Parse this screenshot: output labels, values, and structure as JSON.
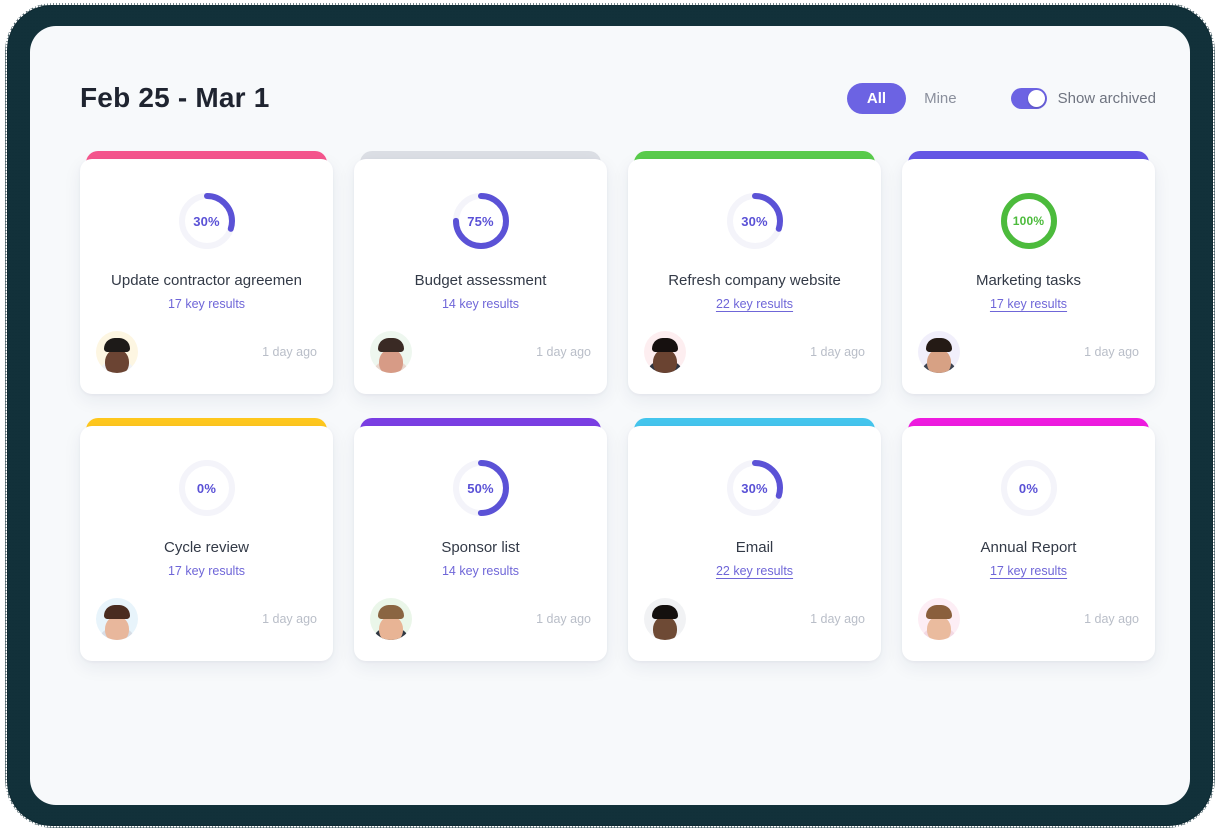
{
  "header": {
    "title": "Feb 25 - Mar 1",
    "filter_all": "All",
    "filter_mine": "Mine",
    "show_archived_label": "Show archived",
    "toggle_state": "on",
    "accent_color": "#6c63e3"
  },
  "cards": [
    {
      "title": "Update contractor agreemen",
      "key_results": "17 key results",
      "underlined": false,
      "percent": 30,
      "percent_label": "30%",
      "accent_color": "#f5558d",
      "ring_color": "#5b52d6",
      "time": "1 day ago",
      "avatar": {
        "name": "avatar-user-1",
        "bg": "#fdf6e2",
        "skin": "#6b4433",
        "hair": "#1d1a18",
        "body": "#f0f2f5"
      }
    },
    {
      "title": "Budget assessment",
      "key_results": "14 key results",
      "underlined": false,
      "percent": 75,
      "percent_label": "75%",
      "accent_color": "#dcdfe5",
      "ring_color": "#5b52d6",
      "time": "1 day ago",
      "avatar": {
        "name": "avatar-user-2",
        "bg": "#eef7ef",
        "skin": "#d79b86",
        "hair": "#3a2a24",
        "body": "#e9d8cf"
      }
    },
    {
      "title": "Refresh company website",
      "key_results": "22 key results",
      "underlined": true,
      "percent": 30,
      "percent_label": "30%",
      "accent_color": "#59cc4b",
      "ring_color": "#5b52d6",
      "time": "1 day ago",
      "avatar": {
        "name": "avatar-user-3",
        "bg": "#fdeef0",
        "skin": "#6a4331",
        "hair": "#16100f",
        "body": "#2c3340"
      }
    },
    {
      "title": "Marketing tasks",
      "key_results": "17 key results",
      "underlined": true,
      "percent": 100,
      "percent_label": "100%",
      "accent_color": "#6556e6",
      "ring_color": "#4cbb3c",
      "time": "1 day ago",
      "avatar": {
        "name": "avatar-user-4",
        "bg": "#f1effb",
        "skin": "#d7a184",
        "hair": "#241a15",
        "body": "#3b4250"
      }
    },
    {
      "title": "Cycle review",
      "key_results": "17 key results",
      "underlined": false,
      "percent": 0,
      "percent_label": "0%",
      "accent_color": "#ffc81e",
      "ring_color": "#5b52d6",
      "time": "1 day ago",
      "avatar": {
        "name": "avatar-user-5",
        "bg": "#e8f4fb",
        "skin": "#e8b79c",
        "hair": "#4a2c20",
        "body": "#d7dde6"
      }
    },
    {
      "title": "Sponsor list",
      "key_results": "14 key results",
      "underlined": false,
      "percent": 50,
      "percent_label": "50%",
      "accent_color": "#7b3fe4",
      "ring_color": "#5b52d6",
      "time": "1 day ago",
      "avatar": {
        "name": "avatar-user-6",
        "bg": "#eaf6e9",
        "skin": "#e8b495",
        "hair": "#8a6542",
        "body": "#2f3642"
      }
    },
    {
      "title": "Email",
      "key_results": "22 key results",
      "underlined": true,
      "percent": 30,
      "percent_label": "30%",
      "accent_color": "#45c6ee",
      "ring_color": "#5b52d6",
      "time": "1 day ago",
      "avatar": {
        "name": "avatar-user-7",
        "bg": "#f1f2f4",
        "skin": "#6e4a35",
        "hair": "#14100e",
        "body": "#f4f5f7"
      }
    },
    {
      "title": "Annual Report",
      "key_results": "17 key results",
      "underlined": true,
      "percent": 0,
      "percent_label": "0%",
      "accent_color": "#ef1ce0",
      "ring_color": "#5b52d6",
      "time": "1 day ago",
      "avatar": {
        "name": "avatar-user-8",
        "bg": "#fdeef5",
        "skin": "#eabb9e",
        "hair": "#8a5f3c",
        "body": "#f3d9e4"
      }
    }
  ]
}
